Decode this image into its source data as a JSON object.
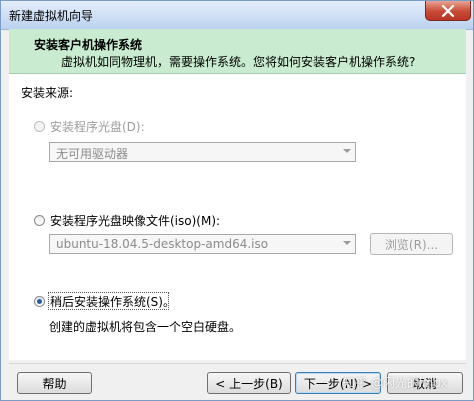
{
  "window": {
    "title": "新建虚拟机向导",
    "close_icon": "close-icon",
    "close_color": "#c74a36"
  },
  "header": {
    "title": "安装客户机操作系统",
    "description": "虚拟机如同物理机，需要操作系统。您将如何安装客户机操作系统?",
    "background": "#c9ecd1"
  },
  "install_source": {
    "label": "安装来源:",
    "options": [
      {
        "label": "安装程序光盘(D):",
        "selected": false,
        "enabled": false
      },
      {
        "label": "安装程序光盘映像文件(iso)(M):",
        "selected": false,
        "enabled": true
      },
      {
        "label": "稍后安装操作系统(S)。",
        "selected": true,
        "enabled": true
      }
    ],
    "disc_drive": {
      "value": "无可用驱动器"
    },
    "iso_path": {
      "value": "ubuntu-18.04.5-desktop-amd64.iso",
      "browse_label": "浏览(R)..."
    },
    "later_hint": "创建的虚拟机将包含一个空白硬盘。"
  },
  "footer": {
    "help": "帮助",
    "back": "< 上一步(B)",
    "next": "下一步(N) >",
    "cancel": "取消"
  },
  "watermark": "知乎 @闪光的linux"
}
